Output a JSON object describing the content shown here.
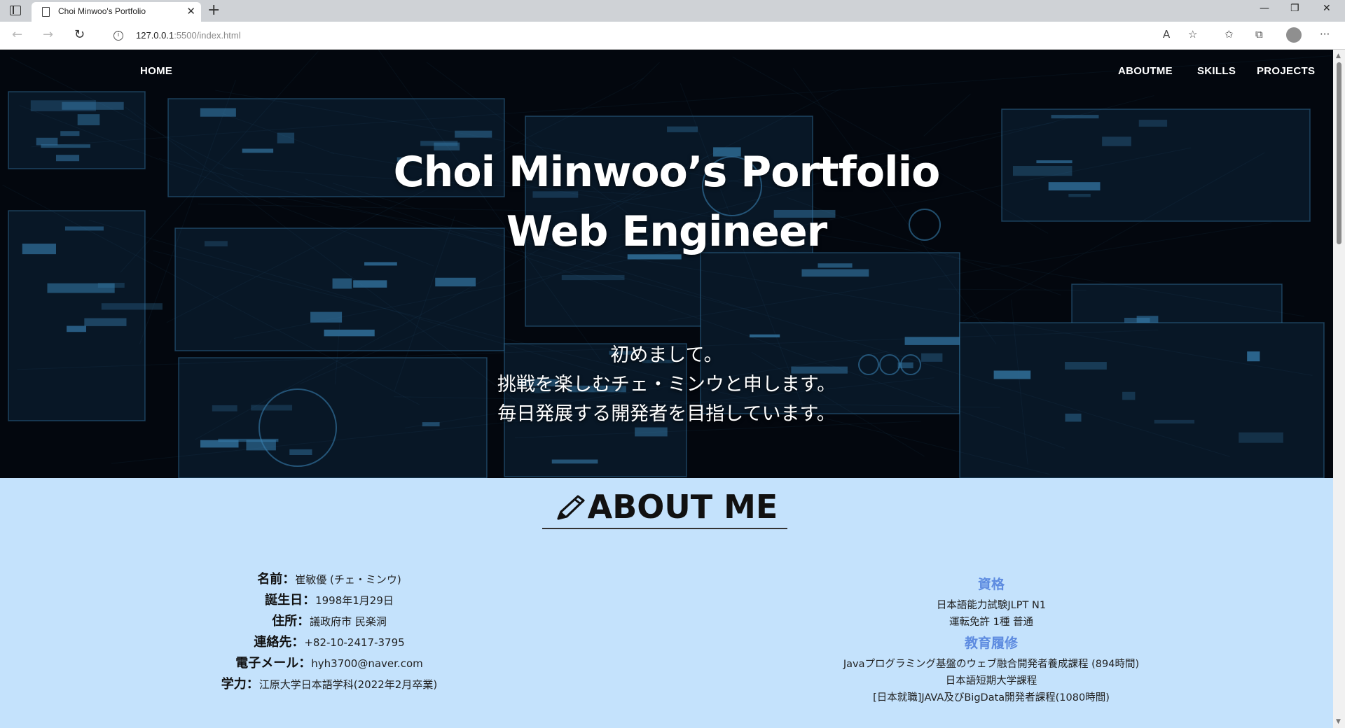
{
  "browser": {
    "tab_title": "Choi Minwoo's Portfolio",
    "url_host": "127.0.0.1",
    "url_path": ":5500/index.html"
  },
  "nav": {
    "home": "HOME",
    "aboutme": "ABOUTME",
    "skills": "SKILLS",
    "projects": "PROJECTS"
  },
  "hero": {
    "title_line1": "Choi Minwoo’s Portfolio",
    "title_line2": "Web Engineer",
    "intro": [
      "初めまして。",
      "挑戦を楽しむチェ・ミンウと申します。",
      "毎日発展する開発者を目指しています。"
    ]
  },
  "about": {
    "heading": "ABOUT ME",
    "profile": [
      {
        "label": "名前：",
        "value": "崔敏優 (チェ・ミンウ)"
      },
      {
        "label": "誕生日：",
        "value": "1998年1月29日"
      },
      {
        "label": "住所：",
        "value": "議政府市 民楽洞"
      },
      {
        "label": "連絡先：",
        "value": "+82-10-2417-3795"
      },
      {
        "label": "電子メール：",
        "value": "hyh3700@naver.com"
      },
      {
        "label": "学力：",
        "value": "江原大学日本語学科(2022年2月卒業)"
      }
    ],
    "qualifications_heading": "資格",
    "qualifications": [
      "日本語能力試験JLPT N1",
      "運転免許 1種 普通"
    ],
    "education_heading": "教育履修",
    "education": [
      "Javaプログラミング基盤のウェブ融合開発者養成課程 (894時間)",
      "日本語短期大学課程",
      "[日本就職]JAVA及びBigData開発者課程(1080時間)"
    ]
  },
  "colors": {
    "hero_background": "#050b15",
    "hud_accent": "#4aa8e8",
    "about_background": "#c4e2fc",
    "section_heading_blue": "#5d8be0"
  },
  "icons": {
    "heading_icon": "pencil-icon",
    "address_info": "info-icon"
  }
}
